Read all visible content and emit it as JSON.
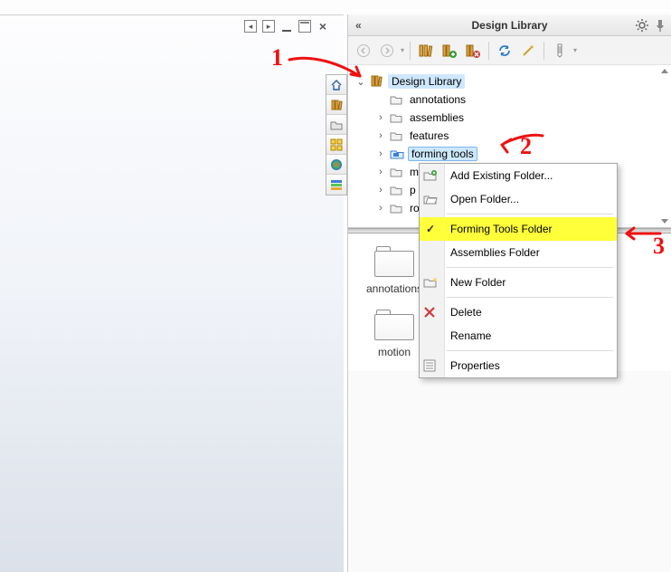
{
  "panel": {
    "title": "Design Library",
    "toolbar_icons": [
      "back",
      "forward",
      "library",
      "library-add",
      "library-del",
      "refresh",
      "sync",
      "param"
    ]
  },
  "tree": {
    "root": "Design Library",
    "items": [
      {
        "label": "annotations",
        "expandable": false
      },
      {
        "label": "assemblies",
        "expandable": true
      },
      {
        "label": "features",
        "expandable": true
      },
      {
        "label": "forming tools",
        "expandable": true,
        "selected": true
      },
      {
        "label": "m",
        "expandable": true
      },
      {
        "label": "p",
        "expandable": true
      },
      {
        "label": "ro",
        "expandable": true
      }
    ]
  },
  "thumbs": [
    {
      "label": "annotations"
    },
    {
      "label": "motion"
    }
  ],
  "context_menu": {
    "items": [
      {
        "label": "Add Existing Folder...",
        "icon": "folder-plus"
      },
      {
        "label": "Open Folder...",
        "icon": "folder-open"
      },
      {
        "sep": true
      },
      {
        "label": "Forming Tools Folder",
        "checked": true,
        "highlight": true
      },
      {
        "label": "Assemblies Folder"
      },
      {
        "sep": true
      },
      {
        "label": "New Folder",
        "icon": "folder-new"
      },
      {
        "sep": true
      },
      {
        "label": "Delete",
        "icon": "delete-x"
      },
      {
        "label": "Rename"
      },
      {
        "sep": true
      },
      {
        "label": "Properties",
        "icon": "properties"
      }
    ]
  },
  "annotations": {
    "n1": "1",
    "n2": "2",
    "n3": "3"
  }
}
